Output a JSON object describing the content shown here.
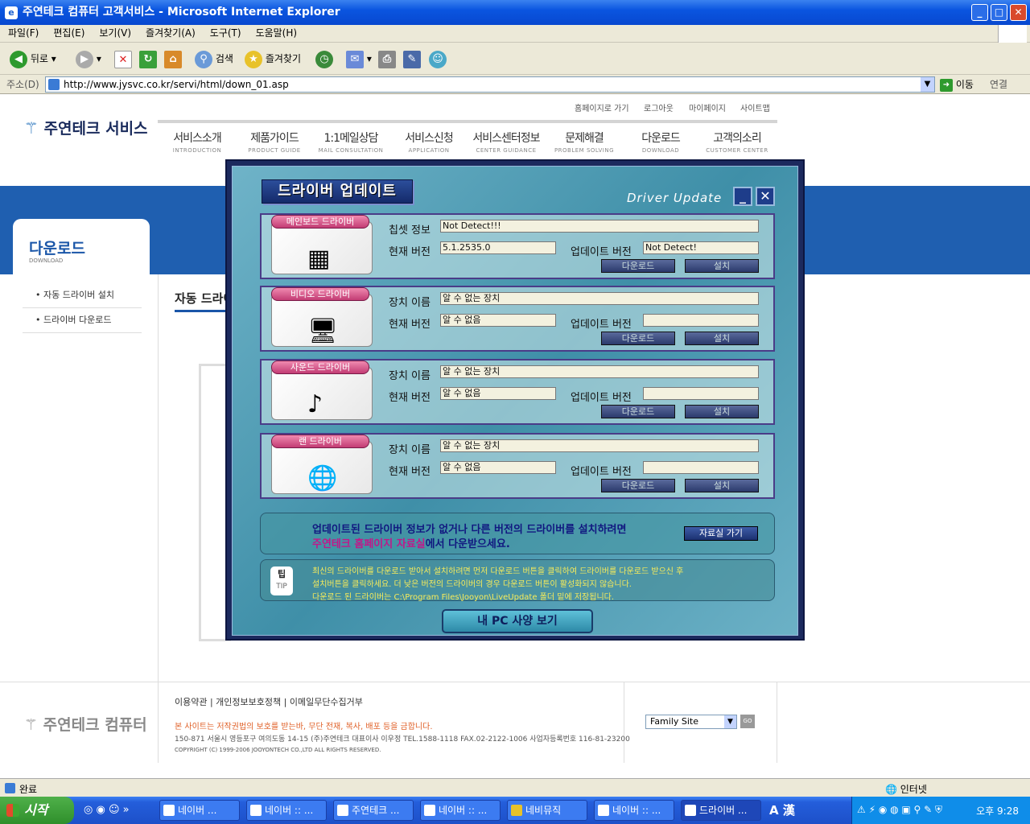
{
  "window": {
    "title": "주연테크 컴퓨터 고객서비스 - Microsoft Internet Explorer"
  },
  "menu": [
    "파일(F)",
    "편집(E)",
    "보기(V)",
    "즐겨찾기(A)",
    "도구(T)",
    "도움말(H)"
  ],
  "toolbar": {
    "back": "뒤로",
    "search": "검색",
    "favorites": "즐겨찾기"
  },
  "address": {
    "label": "주소(D)",
    "url": "http://www.jysvc.co.kr/servi/html/down_01.asp",
    "go": "이동",
    "links": "연결"
  },
  "site": {
    "logo": "주연테크 서비스",
    "top_links": [
      "홈페이지로 가기",
      "로그아웃",
      "마이페이지",
      "사이트맵"
    ],
    "nav": [
      {
        "ko": "서비스소개",
        "en": "INTRODUCTION"
      },
      {
        "ko": "제품가이드",
        "en": "PRODUCT GUIDE"
      },
      {
        "ko": "1:1메일상담",
        "en": "MAIL CONSULTATION"
      },
      {
        "ko": "서비스신청",
        "en": "APPLICATION"
      },
      {
        "ko": "서비스센터정보",
        "en": "CENTER GUIDANCE"
      },
      {
        "ko": "문제해결",
        "en": "PROBLEM SOLVING"
      },
      {
        "ko": "다운로드",
        "en": "DOWNLOAD"
      },
      {
        "ko": "고객의소리",
        "en": "CUSTOMER CENTER"
      }
    ],
    "section_title": "다운로드",
    "section_sub": "DOWNLOAD",
    "side_items": [
      "자동 드라이버 설치",
      "드라이버 다운로드"
    ],
    "content_title": "자동 드라이",
    "footer": {
      "logo": "주연테크 컴퓨터",
      "links": "이용약관 | 개인정보보호정책 | 이메일무단수집거부",
      "warning": "본 사이트는 저작권법의 보호를 받는바, 무단 전재, 복사, 배포 등을 금합니다.",
      "address": "150-871 서울시 영등포구 여의도동 14-15 (주)주연테크  대표이사 이우정  TEL.1588-1118  FAX.02-2122-1006  사업자등록번호 116-81-23200",
      "copyright": "COPYRIGHT (C) 1999-2006 JOOYONTECH CO.,LTD ALL RIGHTS RESERVED.",
      "family_site": "Family Site"
    }
  },
  "popup": {
    "title": "드라이버 업데이트",
    "title_en": "Driver Update",
    "drivers": [
      {
        "tag": "메인보드 드라이버",
        "icon": "chip-icon",
        "name_label": "칩셋 정보",
        "name": "Not Detect!!!",
        "cur_label": "현재 버전",
        "cur": "5.1.2535.0",
        "upd_label": "업데이트 버전",
        "upd": "Not Detect!",
        "download": "다운로드",
        "install": "설치"
      },
      {
        "tag": "비디오 드라이버",
        "icon": "monitor-palette-icon",
        "name_label": "장치 이름",
        "name": "알 수 없는 장치",
        "cur_label": "현재 버전",
        "cur": "알 수 없음",
        "upd_label": "업데이트 버전",
        "upd": "",
        "download": "다운로드",
        "install": "설치"
      },
      {
        "tag": "사운드 드라이버",
        "icon": "speaker-icon",
        "name_label": "장치 이름",
        "name": "알 수 없는 장치",
        "cur_label": "현재 버전",
        "cur": "알 수 없음",
        "upd_label": "업데이트 버전",
        "upd": "",
        "download": "다운로드",
        "install": "설치"
      },
      {
        "tag": "랜 드라이버",
        "icon": "globe-icon",
        "name_label": "장치 이름",
        "name": "알 수 없는 장치",
        "cur_label": "현재 버전",
        "cur": "알 수 없음",
        "upd_label": "업데이트 버전",
        "upd": "",
        "download": "다운로드",
        "install": "설치"
      }
    ],
    "note_line1": "업데이트된 드라이버 정보가 없거나 다른 버전의 드라이버를 설치하려면",
    "note_link": "주연테크 홈페이지 자료실",
    "note_line2_rest": "에서 다운받으세요.",
    "note_button": "자료실 가기",
    "tip_label": "팁",
    "tip_label_en": "TIP",
    "tip_lines": [
      "최신의 드라이버를 다운로드 받아서 설치하려면 먼저 다운로드 버튼을 클릭하여 드라이버를 다운로드 받으신 후",
      "설치버튼을 클릭하세요. 더 낮은 버전의 드라이버의 경우 다운로드 버튼이 활성화되지 않습니다.",
      "다운로드 된 드라이버는 C:\\Program Files\\Jooyon\\LiveUpdate 폴더 밑에 저장됩니다."
    ],
    "pc_button": "내 PC 사양 보기"
  },
  "status": {
    "text": "완료",
    "zone": "인터넷"
  },
  "taskbar": {
    "start": "시작",
    "tasks": [
      "네이버 ...",
      "네이버 :: ...",
      "주연테크 ...",
      "네이버 :: ...",
      "네비뮤직",
      "네이버 :: ...",
      "드라이버 ..."
    ],
    "lang": "A 漢",
    "time": "오후 9:28"
  }
}
